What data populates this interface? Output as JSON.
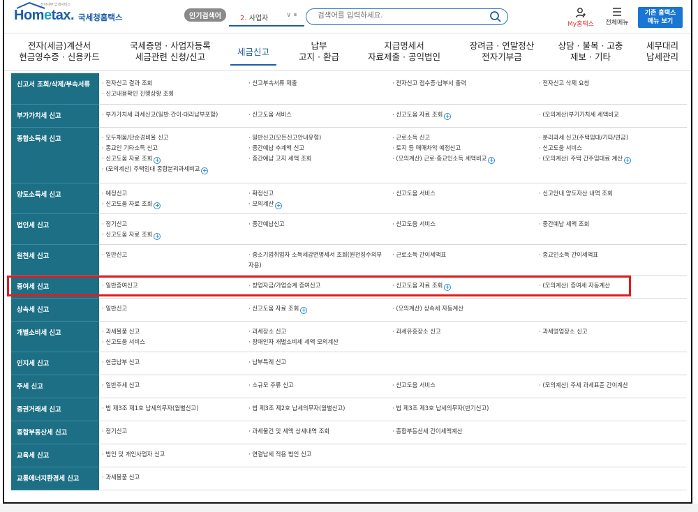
{
  "header": {
    "logo_tiny": "전자세무 납세서비스",
    "logo_prefix": "Hom",
    "logo_e": "e",
    "logo_suffix": "tax.",
    "logo_sub": "국세청홈택스",
    "popular_label": "인기검색어",
    "search_type_num": "2.",
    "search_type_label": "사업자",
    "search_placeholder": "검색어를 입력하세요.",
    "my_label": "My홈택스",
    "allmenu_label": "전체메뉴",
    "old_menu_line1": "기존 홈택스",
    "old_menu_line2": "메뉴 보기"
  },
  "nav": {
    "items": [
      {
        "line1": "전자(세금)계산서",
        "line2": "현금영수증 · 신용카드"
      },
      {
        "line1": "국세증명 · 사업자등록",
        "line2": "세금관련 신청/신고"
      },
      {
        "line1": "세금신고",
        "line2": ""
      },
      {
        "line1": "납부",
        "line2": "고지 · 환급"
      },
      {
        "line1": "지급명세서",
        "line2": "자료제출 · 공익법인"
      },
      {
        "line1": "장려금 · 연말정산",
        "line2": "전자기부금"
      },
      {
        "line1": "상담 · 불복 · 고충",
        "line2": "제보 · 기타"
      },
      {
        "line1": "세무대리",
        "line2": "납세관리"
      }
    ]
  },
  "rows": [
    {
      "cat": "신고서 조회/삭제/부속서류",
      "cols": [
        [
          {
            "t": "· 전자신고 결과 조회"
          },
          {
            "t": "· 신고내용확인 진행상황 조회"
          }
        ],
        [
          {
            "t": "· 신고부속서류 제출"
          }
        ],
        [
          {
            "t": "· 전자신고 접수증·납부서 출력"
          }
        ],
        [
          {
            "t": "· 전자신고 삭제 요청"
          }
        ]
      ]
    },
    {
      "cat": "부가가치세 신고",
      "cols": [
        [
          {
            "t": "· 부가가치세 과세신고(일반·간이·대리납부포함)"
          }
        ],
        [
          {
            "t": "· 신고도움 서비스"
          }
        ],
        [
          {
            "t": "· 신고도움 자료 조회",
            "p": true
          }
        ],
        [
          {
            "t": "· (모의계산)부가가치세 세액비교"
          }
        ]
      ]
    },
    {
      "cat": "종합소득세 신고",
      "cols": [
        [
          {
            "t": "· 모두채움/단순경비율 신고"
          },
          {
            "t": "· 종교인 기타소득 신고"
          },
          {
            "t": "· 신고도움 자료 조회",
            "p": true
          },
          {
            "t": "· (모의계산) 주택임대 종합분리과세비교",
            "p": true
          }
        ],
        [
          {
            "t": "· 일반신고(모든신고안내유형)"
          },
          {
            "t": "· 중간예납 추계액 신고"
          },
          {
            "t": "· 중간예납 고지 세액 조회"
          }
        ],
        [
          {
            "t": "· 근로소득 신고"
          },
          {
            "t": "· 토지 등 매매차익 예정신고"
          },
          {
            "t": "· (모의계산) 근로·종교인소득 세액비교",
            "p": true
          }
        ],
        [
          {
            "t": "· 분리과세 신고(주택임대/기타/연금)"
          },
          {
            "t": "· 신고도움 서비스"
          },
          {
            "t": "· (모의계산) 주택 간주임대료 계산",
            "p": true
          }
        ]
      ]
    },
    {
      "cat": "양도소득세 신고",
      "cols": [
        [
          {
            "t": "· 예정신고"
          },
          {
            "t": "· 신고도움 자료 조회",
            "p": true
          }
        ],
        [
          {
            "t": "· 확정신고"
          },
          {
            "t": "· 모의계산",
            "p": true
          }
        ],
        [
          {
            "t": "· 신고도움 서비스"
          }
        ],
        [
          {
            "t": "· 신고안내 양도자산 내역 조회"
          }
        ]
      ]
    },
    {
      "cat": "법인세 신고",
      "cols": [
        [
          {
            "t": "· 정기신고"
          },
          {
            "t": "· 신고도움 자료 조회",
            "p": true
          }
        ],
        [
          {
            "t": "· 중간예납신고"
          }
        ],
        [
          {
            "t": "· 신고도움 서비스"
          }
        ],
        [
          {
            "t": "· 중간예납 세액 조회"
          }
        ]
      ]
    },
    {
      "cat": "원천세 신고",
      "cols": [
        [
          {
            "t": "· 일반신고"
          }
        ],
        [
          {
            "t": "· 중소기업취업자 소득세감면명세서 조회(원천징수의무자용)",
            "w": true
          }
        ],
        [
          {
            "t": "· 근로소득 간이세액표"
          }
        ],
        [
          {
            "t": "· 종교인소득 간이세액표"
          }
        ]
      ]
    },
    {
      "cat": "증여세 신고",
      "cols": [
        [
          {
            "t": "· 일반증여신고"
          }
        ],
        [
          {
            "t": "· 창업자금/가업승계 증여신고"
          }
        ],
        [
          {
            "t": "· 신고도움 자료 조회",
            "p": true
          }
        ],
        [
          {
            "t": "· (모의계산) 증여세 자동계산"
          }
        ]
      ]
    },
    {
      "cat": "상속세 신고",
      "cols": [
        [
          {
            "t": "· 일반신고"
          }
        ],
        [
          {
            "t": "· 신고도움 자료 조회",
            "p": true
          }
        ],
        [
          {
            "t": "· (모의계산) 상속세 자동계산"
          }
        ],
        []
      ]
    },
    {
      "cat": "개별소비세 신고",
      "cols": [
        [
          {
            "t": "· 과세물품 신고"
          },
          {
            "t": "· 신고도움 서비스"
          }
        ],
        [
          {
            "t": "· 과세장소 신고"
          },
          {
            "t": "· 장애인자 개별소비세 세액 모의계산"
          }
        ],
        [
          {
            "t": "· 과세유흥장소 신고"
          }
        ],
        [
          {
            "t": "· 과세영업장소 신고"
          }
        ]
      ]
    },
    {
      "cat": "인지세 신고",
      "cols": [
        [
          {
            "t": "· 현금납부 신고"
          }
        ],
        [
          {
            "t": "· 납부특례 신고"
          }
        ],
        [],
        []
      ]
    },
    {
      "cat": "주세 신고",
      "cols": [
        [
          {
            "t": "· 일반주세 신고"
          }
        ],
        [
          {
            "t": "· 소규모 주류 신고"
          }
        ],
        [
          {
            "t": "· 신고도움 서비스"
          }
        ],
        [
          {
            "t": "· (모의계산) 주세 과세표준 간이계산"
          }
        ]
      ]
    },
    {
      "cat": "증권거래세 신고",
      "cols": [
        [
          {
            "t": "· 법 제3조 제1호 납세의무자(월별신고)"
          }
        ],
        [
          {
            "t": "· 법 제3조 제2호 납세의무자(월별신고)"
          }
        ],
        [
          {
            "t": "· 법 제3조 제3호 납세의무자(반기신고)"
          }
        ],
        []
      ]
    },
    {
      "cat": "종합부동산세 신고",
      "cols": [
        [
          {
            "t": "· 정기신고"
          }
        ],
        [
          {
            "t": "· 과세물건 및 세액 상세내역 조회"
          }
        ],
        [
          {
            "t": "· 종합부동산세 간이세액계산"
          }
        ],
        []
      ]
    },
    {
      "cat": "교육세 신고",
      "cols": [
        [
          {
            "t": "· 법인 및 개인사업자 신고"
          }
        ],
        [
          {
            "t": "· 연결납세 적용 법인 신고"
          }
        ],
        [],
        []
      ]
    },
    {
      "cat": "교통에너지환경세 신고",
      "cols": [
        [
          {
            "t": "· 과세물품 신고"
          }
        ],
        [],
        [],
        []
      ]
    }
  ],
  "colors": {
    "category_bg": "#1c6f84",
    "brand_blue": "#1c5ca8",
    "highlight": "#e41c1c",
    "old_menu_btn": "#1976d2"
  }
}
